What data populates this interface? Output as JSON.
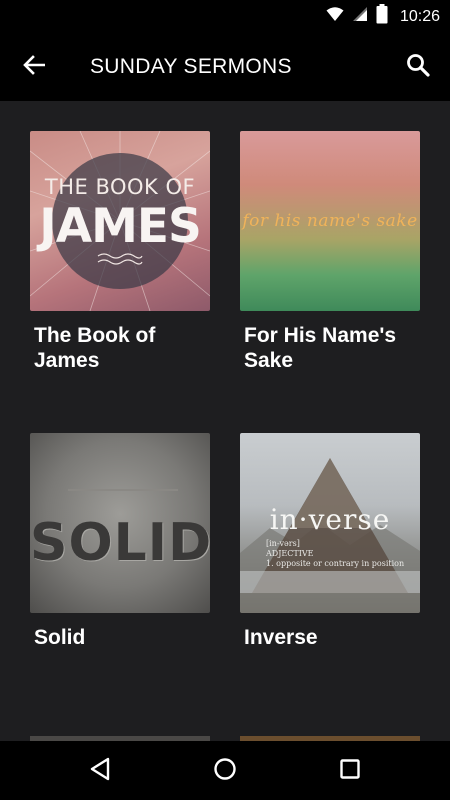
{
  "status_bar": {
    "time": "10:26",
    "icons": [
      "wifi-icon",
      "signal-icon",
      "battery-icon"
    ]
  },
  "toolbar": {
    "title": "SUNDAY SERMONS",
    "back_icon": "arrow-left-icon",
    "search_icon": "search-icon"
  },
  "series": [
    {
      "title": "The Book of James",
      "art_lines": [
        "THE BOOK OF",
        "JAMES"
      ]
    },
    {
      "title": "For His Name's Sake",
      "art_lines": [
        "for his name's sake"
      ]
    },
    {
      "title": "Solid",
      "art_lines": [
        "SOLID"
      ]
    },
    {
      "title": "Inverse",
      "art_lines": [
        "in·verse",
        "[in-vərs]",
        "ADJECTIVE",
        "1. opposite or contrary in position"
      ]
    }
  ],
  "nav_bar": {
    "icons": [
      "back-triangle-icon",
      "home-circle-icon",
      "recents-square-icon"
    ]
  },
  "colors": {
    "background": "#1e1e20",
    "bars": "#000000",
    "text": "#ffffff"
  }
}
